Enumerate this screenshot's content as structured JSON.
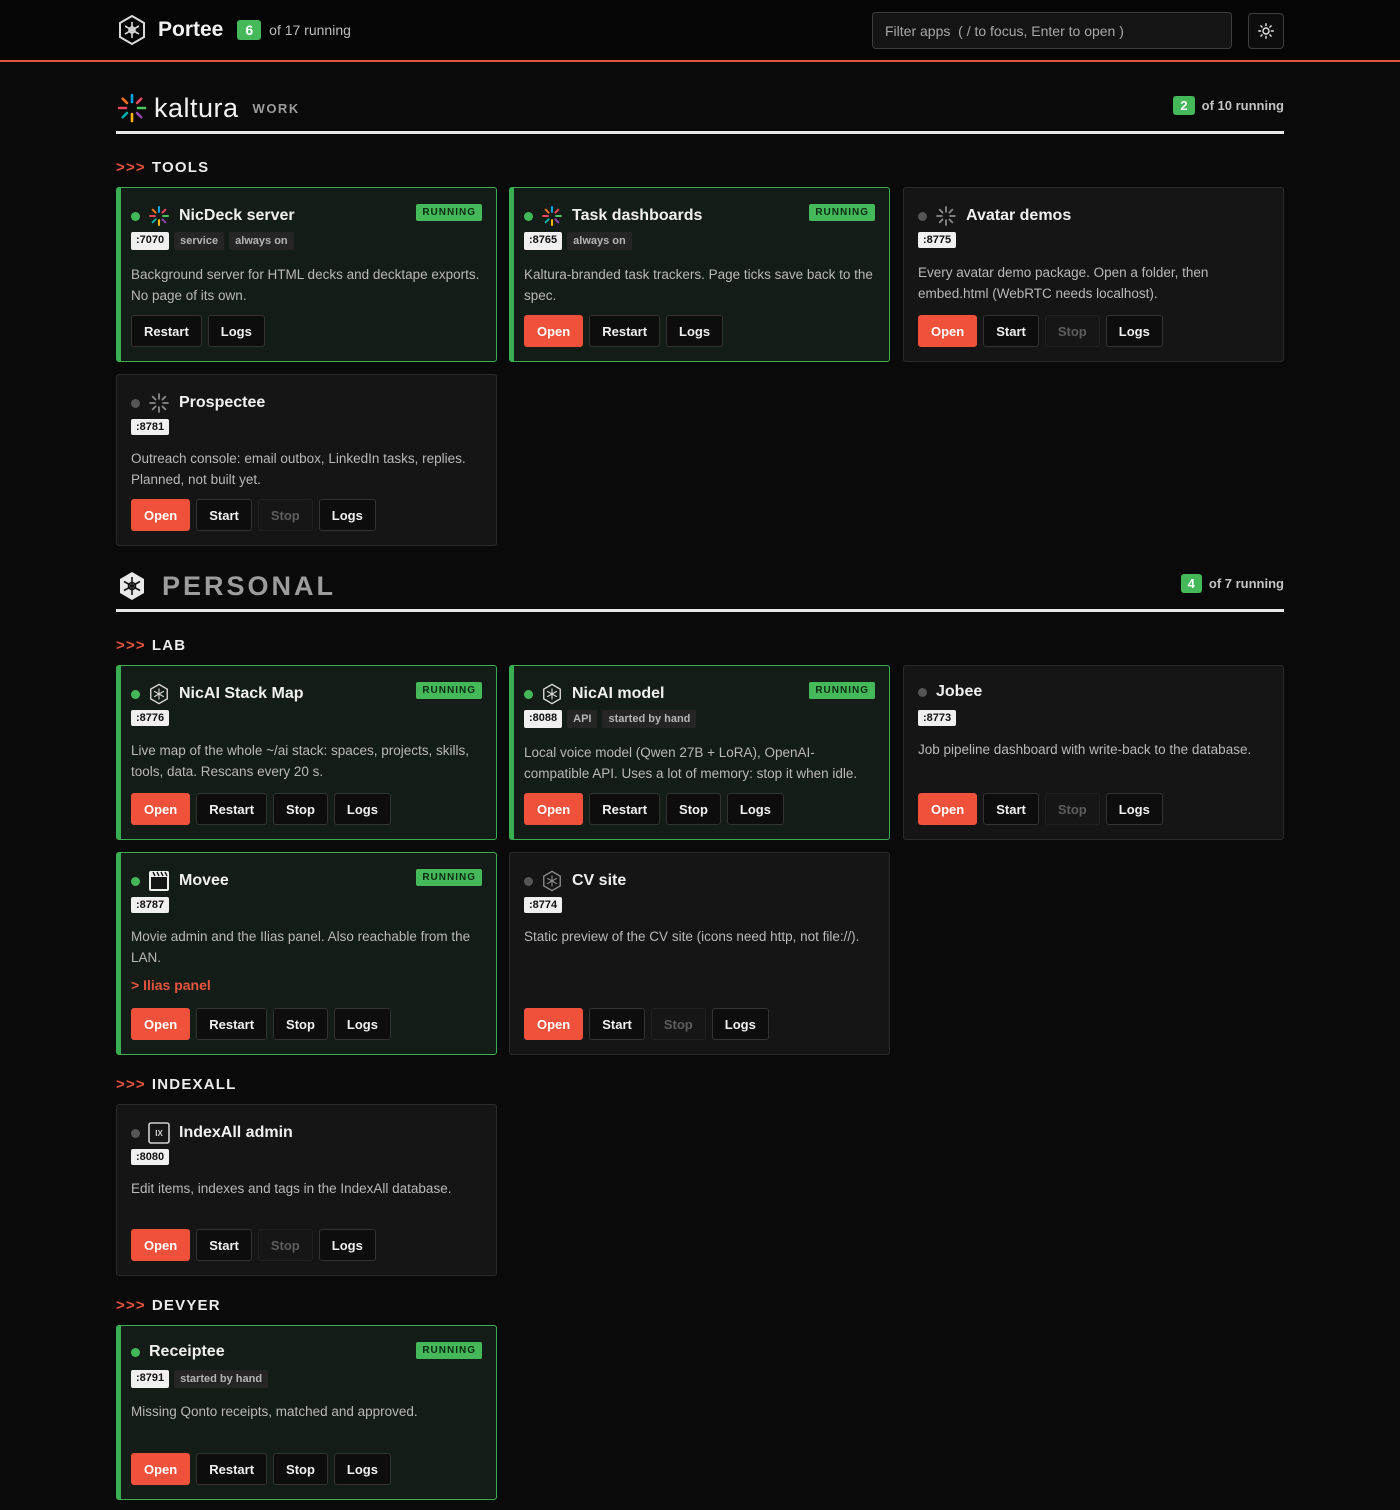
{
  "header": {
    "title": "Portee",
    "running_count": "6",
    "running_of": "of 17 running",
    "filter_placeholder": "Filter apps  ( / to focus, Enter to open )"
  },
  "colors": {
    "accent": "#e65440",
    "running_green": "#45b95a",
    "background": "#0a0a0a"
  },
  "groups": {
    "kaltura": {
      "name": "kaltura",
      "tag": "WORK",
      "count": "2",
      "of": "of 10 running"
    },
    "personal": {
      "name": "PERSONAL",
      "count": "4",
      "of": "of 7 running"
    }
  },
  "sections": {
    "tools": {
      "arrows": ">>>",
      "label": "TOOLS"
    },
    "lab": {
      "arrows": ">>>",
      "label": "LAB"
    },
    "indexall": {
      "arrows": ">>>",
      "label": "INDEXALL"
    },
    "devyer": {
      "arrows": ">>>",
      "label": "DEVYER"
    }
  },
  "running_badge": "RUNNING",
  "apps": {
    "nicdeck": {
      "title": "NicDeck server",
      "port": ":7070",
      "tags": [
        "service",
        "always on"
      ],
      "desc": "Background server for HTML decks and decktape exports. No page of its own.",
      "buttons": [
        "Restart",
        "Logs"
      ],
      "icon": "kaltura-spark-icon"
    },
    "taskdash": {
      "title": "Task dashboards",
      "port": ":8765",
      "tags": [
        "always on"
      ],
      "desc": "Kaltura-branded task trackers. Page ticks save back to the spec.",
      "buttons": [
        "Open",
        "Restart",
        "Logs"
      ],
      "icon": "kaltura-spark-icon"
    },
    "avatar": {
      "title": "Avatar demos",
      "port": ":8775",
      "desc": "Every avatar demo package. Open a folder, then embed.html (WebRTC needs localhost).",
      "buttons": [
        "Open",
        "Start",
        "Stop",
        "Logs"
      ],
      "icon": "spinner-icon"
    },
    "prospectee": {
      "title": "Prospectee",
      "port": ":8781",
      "desc": "Outreach console: email outbox, LinkedIn tasks, replies. Planned, not built yet.",
      "buttons": [
        "Open",
        "Start",
        "Stop",
        "Logs"
      ],
      "icon": "spinner-icon"
    },
    "stackmap": {
      "title": "NicAI Stack Map",
      "port": ":8776",
      "desc": "Live map of the whole ~/ai stack: spaces, projects, skills, tools, data. Rescans every 20 s.",
      "buttons": [
        "Open",
        "Restart",
        "Stop",
        "Logs"
      ],
      "icon": "nicai-star-icon"
    },
    "nicaimodel": {
      "title": "NicAI model",
      "port": ":8088",
      "tags": [
        "API",
        "started by hand"
      ],
      "desc": "Local voice model (Qwen 27B + LoRA), OpenAI-compatible API. Uses a lot of memory: stop it when idle.",
      "buttons": [
        "Open",
        "Restart",
        "Stop",
        "Logs"
      ],
      "icon": "nicai-star-icon"
    },
    "jobee": {
      "title": "Jobee",
      "port": ":8773",
      "desc": "Job pipeline dashboard with write-back to the database.",
      "buttons": [
        "Open",
        "Start",
        "Stop",
        "Logs"
      ]
    },
    "movee": {
      "title": "Movee",
      "port": ":8787",
      "desc": "Movie admin and the Ilias panel. Also reachable from the LAN.",
      "link": "> Ilias panel",
      "buttons": [
        "Open",
        "Restart",
        "Stop",
        "Logs"
      ],
      "icon": "clapperboard-icon"
    },
    "cvsite": {
      "title": "CV site",
      "port": ":8774",
      "desc": "Static preview of the CV site (icons need http, not file://).",
      "buttons": [
        "Open",
        "Start",
        "Stop",
        "Logs"
      ],
      "icon": "nicai-star-icon"
    },
    "indexall": {
      "title": "IndexAll admin",
      "port": ":8080",
      "desc": "Edit items, indexes and tags in the IndexAll database.",
      "buttons": [
        "Open",
        "Start",
        "Stop",
        "Logs"
      ],
      "icon": "ix-icon",
      "icon_text": "IX"
    },
    "receiptee": {
      "title": "Receiptee",
      "port": ":8791",
      "tags": [
        "started by hand"
      ],
      "desc": "Missing Qonto receipts, matched and approved.",
      "buttons": [
        "Open",
        "Restart",
        "Stop",
        "Logs"
      ]
    }
  }
}
